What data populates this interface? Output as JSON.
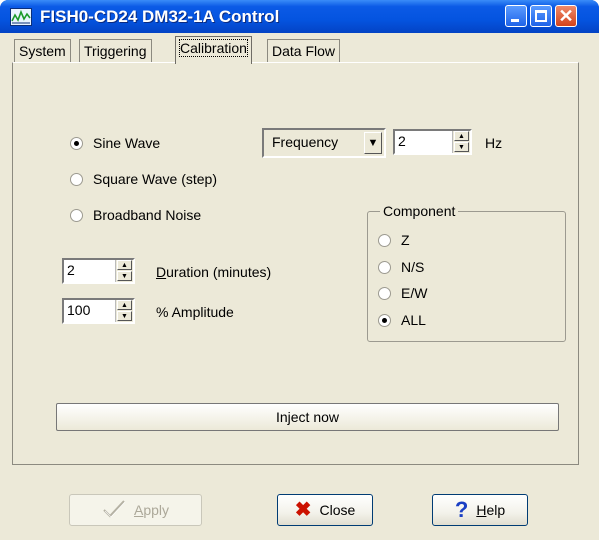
{
  "window": {
    "title": "FISH0-CD24 DM32-1A Control",
    "icons": {
      "app": "app-icon",
      "minimize": "minimize-icon",
      "maximize": "maximize-icon",
      "close": "close-icon"
    }
  },
  "tabs": [
    {
      "label": "System",
      "active": false
    },
    {
      "label": "Triggering",
      "active": false
    },
    {
      "label": "Calibration",
      "active": true
    },
    {
      "label": "Data Flow",
      "active": false
    }
  ],
  "calibration": {
    "waveform_options": [
      {
        "label": "Sine Wave",
        "selected": true
      },
      {
        "label": "Square Wave (step)",
        "selected": false
      },
      {
        "label": "Broadband Noise",
        "selected": false
      }
    ],
    "mode_select": {
      "value": "Frequency"
    },
    "frequency": {
      "value": "2",
      "unit": "Hz"
    },
    "duration": {
      "value": "2",
      "label": "Duration (minutes)"
    },
    "amplitude": {
      "value": "100",
      "label": "% Amplitude"
    },
    "component": {
      "title": "Component",
      "options": [
        {
          "label": "Z",
          "selected": false
        },
        {
          "label": "N/S",
          "selected": false
        },
        {
          "label": "E/W",
          "selected": false
        },
        {
          "label": "ALL",
          "selected": true
        }
      ]
    },
    "inject_label": "Inject now"
  },
  "buttons": {
    "apply": {
      "label": "Apply",
      "enabled": false,
      "icon": "checkmark-icon"
    },
    "close": {
      "label": "Close",
      "enabled": true,
      "icon": "red-x-icon"
    },
    "help": {
      "label": "Help",
      "enabled": true,
      "icon": "question-mark-icon"
    }
  },
  "colors": {
    "titlebar": "#0454e0",
    "dialog_bg": "#ece9d8",
    "close_x": "#cc1100",
    "help_q": "#1a3fc4"
  }
}
